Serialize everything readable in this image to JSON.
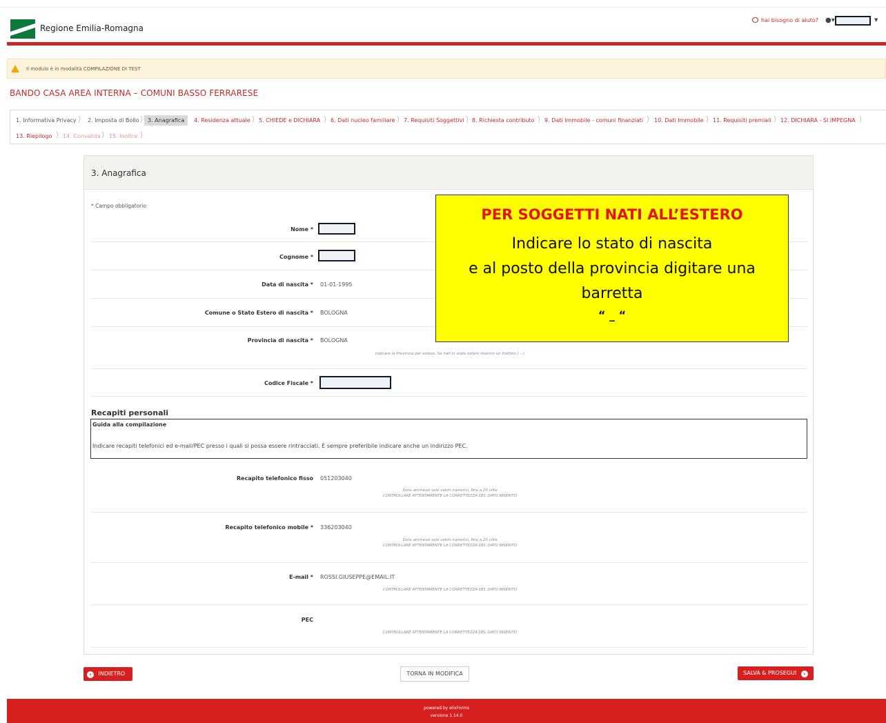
{
  "header": {
    "logo_text": "Regione Emilia-Romagna",
    "help_link": "hai bisogno di aiuto?",
    "brand_color": "#c62828"
  },
  "alert": {
    "text": "Il modulo è in modalità COMPILAZIONE DI TEST"
  },
  "bando_title": "BANDO CASA AREA INTERNA – COMUNI BASSO FERRARESE",
  "steps": [
    "1. Informativa Privacy",
    "2. Imposta di Bollo",
    "3. Anagrafica",
    "4. Residenza attuale",
    "5. CHIEDE e DICHIARA",
    "6. Dati nucleo familiare",
    "7. Requisiti Soggettivi",
    "8. Richiesta contributo",
    "9. Dati Immobile - comuni finanziati",
    "10. Dati Immobile",
    "11. Requisiti premiali",
    "12. DICHIARA - SI IMPEGNA",
    "13. Riepilogo",
    "14. Convalida",
    "15. Inoltra"
  ],
  "panel": {
    "title": "3. Anagrafica",
    "required_note": "* Campo obbligatorio"
  },
  "fields": {
    "nome": {
      "label": "Nome *"
    },
    "cognome": {
      "label": "Cognome *"
    },
    "data_nascita": {
      "label": "Data di nascita *",
      "value": "01-01-1995"
    },
    "comune_nascita": {
      "label": "Comune o Stato Estero di nascita *",
      "value": "BOLOGNA"
    },
    "provincia_nascita": {
      "label": "Provincia di nascita *",
      "value": "BOLOGNA",
      "hint": "Indicare la Provincia per esteso. Se nati in stato estero inserire un trattino ( – )"
    },
    "codice_fiscale": {
      "label": "Codice Fiscale *"
    }
  },
  "recapiti": {
    "title": "Recapiti personali",
    "guida_title": "Guida alla compilazione",
    "guida_text": "Indicare recapiti telefonici ed e-mail/PEC presso i quali si possa essere rintracciati. È sempre preferibile indicare anche un indirizzo PEC.",
    "tel_fisso": {
      "label": "Recapito telefonico fisso",
      "value": "051203040",
      "hint1": "Sono ammessi solo valori numerici, fino a 20 cifre",
      "hint2": "CONTROLLARE ATTENTAMENTE LA CORRETTEZZA DEL DATO INSERITO"
    },
    "tel_mobile": {
      "label": "Recapito telefonico mobile *",
      "value": "336203040",
      "hint1": "Sono ammessi solo valori numerici, fino a 20 cifre",
      "hint2": "CONTROLLARE ATTENTAMENTE LA CORRETTEZZA DEL DATO INSERITO"
    },
    "email": {
      "label": "E-mail *",
      "value": "ROSSI.GIUSEPPE@EMAIL.IT",
      "hint": "CONTROLLARE ATTENTAMENTE LA CORRETTEZZA DEL DATO INSERITO"
    },
    "pec": {
      "label": "PEC",
      "hint": "CONTROLLARE ATTENTAMENTE LA CORRETTEZZA DEL DATO INSERITO"
    }
  },
  "callout": {
    "headline": "PER SOGGETTI NATI ALL’ESTERO",
    "line1": "Indicare lo stato di nascita",
    "line2": "e al posto della provincia digitare una",
    "line3": "barretta",
    "line4": "“ _ “"
  },
  "buttons": {
    "back": "INDIETRO",
    "edit": "TORNA IN MODIFICA",
    "save": "SALVA & PROSEGUI"
  },
  "footer": {
    "line1": "powered by elixForms",
    "line2": "versione 1.14.0"
  }
}
